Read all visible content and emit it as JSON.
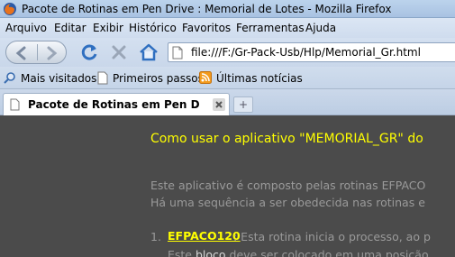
{
  "window": {
    "title": "Pacote de Rotinas em Pen Drive : Memorial de Lotes - Mozilla Firefox"
  },
  "menu": {
    "items": [
      "Arquivo",
      "Editar",
      "Exibir",
      "Histórico",
      "Favoritos",
      "Ferramentas",
      "Ajuda"
    ]
  },
  "navigation": {
    "url": "file:///F:/Gr-Pack-Usb/Hlp/Memorial_Gr.html"
  },
  "bookmarks": {
    "items": [
      "Mais visitados",
      "Primeiros passos",
      "Últimas notícias"
    ]
  },
  "tabs": {
    "active_label": "Pacote de Rotinas em Pen Drive : Me...",
    "new_tab_symbol": "+"
  },
  "page": {
    "heading": "Como usar o aplicativo \"MEMORIAL_GR\" do",
    "para1_line1": "Este aplicativo é composto pelas rotinas EFPACO",
    "para1_line2": "Há uma sequência a ser obedecida nas rotinas e",
    "list_number": "1.",
    "list_link": "EFPACO120",
    "list_rest": ": Esta rotina inicia o processo, ao p",
    "line_after_a": "Este ",
    "line_after_bloco": "bloco",
    "line_after_b": " deve ser colocado em uma posição"
  },
  "colors": {
    "page_background": "#4b4b4b",
    "heading": "#ffff00",
    "body_text": "#9a9a9a"
  }
}
